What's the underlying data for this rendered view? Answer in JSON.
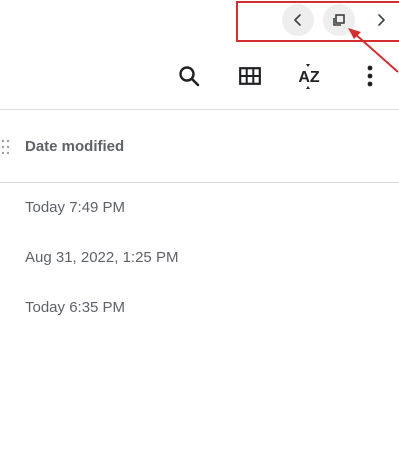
{
  "nav": {
    "back_icon": "chevron-left-icon",
    "restore_icon": "restore-window-icon",
    "forward_icon": "chevron-right-icon"
  },
  "toolbar": {
    "search_icon": "search-icon",
    "grid_icon": "grid-view-icon",
    "sort_label": "AZ",
    "more_icon": "more-vert-icon"
  },
  "table": {
    "column_header": "Date modified",
    "rows": [
      {
        "date": "Today 7:49 PM"
      },
      {
        "date": "Aug 31, 2022, 1:25 PM"
      },
      {
        "date": "Today 6:35 PM"
      }
    ]
  },
  "annotation": {
    "color": "#d32f2f"
  }
}
